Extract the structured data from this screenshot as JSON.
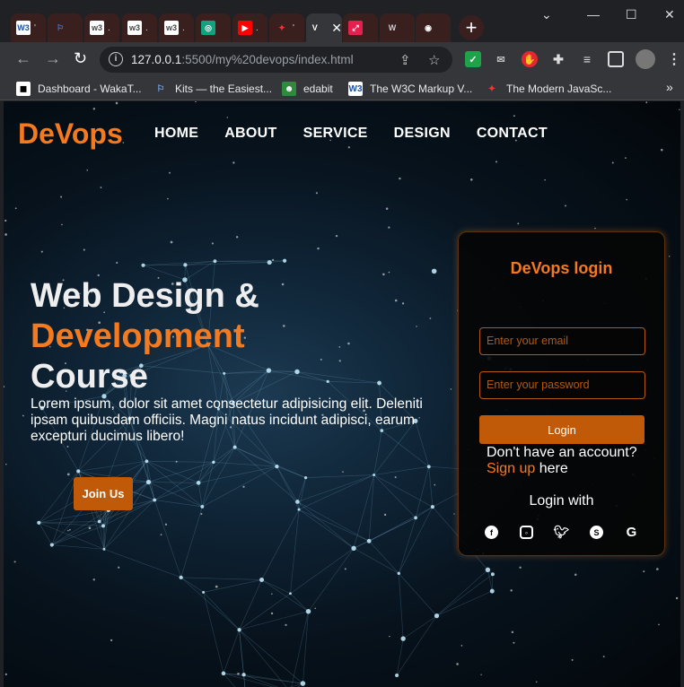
{
  "browser": {
    "tabs": [
      {
        "icon": "W3",
        "label": "'",
        "color": "#1e4fa1",
        "bg": "#fff"
      },
      {
        "icon": "⚐",
        "label": "",
        "color": "#3b82f6",
        "bg": "transparent"
      },
      {
        "icon": "w3",
        "label": ".",
        "color": "#444",
        "bg": "#fff"
      },
      {
        "icon": "w3",
        "label": ".",
        "color": "#444",
        "bg": "#fff"
      },
      {
        "icon": "w3",
        "label": ".",
        "color": "#444",
        "bg": "#fff"
      },
      {
        "icon": "◎",
        "label": "",
        "color": "#fff",
        "bg": "#10a37f"
      },
      {
        "icon": "▶",
        "label": ".",
        "color": "#fff",
        "bg": "#ff0000"
      },
      {
        "icon": "✦",
        "label": "'",
        "color": "#ff3333",
        "bg": "transparent"
      },
      {
        "icon": "V",
        "label": "",
        "color": "#fff",
        "bg": "transparent"
      },
      {
        "icon": "⤢",
        "label": "",
        "color": "#fff",
        "bg": "#e5204f"
      },
      {
        "icon": "W",
        "label": "",
        "color": "#ccc",
        "bg": "transparent"
      },
      {
        "icon": "◉",
        "label": "",
        "color": "#fff",
        "bg": "transparent"
      }
    ],
    "new_tab": "+",
    "url_host": "127.0.0.1",
    "url_rest": ":5500/my%20devops/index.html",
    "bookmarks": [
      {
        "label": "Dashboard - WakaT...",
        "icon": "◼",
        "color": "#000",
        "bg": "#fff"
      },
      {
        "label": "Kits — the Easiest...",
        "icon": "⚐",
        "color": "#6ea8ff",
        "bg": "transparent"
      },
      {
        "label": "edabit",
        "icon": "☻",
        "color": "#fff",
        "bg": "#2e8b3e"
      },
      {
        "label": "The W3C Markup V...",
        "icon": "W3",
        "color": "#1e4fa1",
        "bg": "#fff"
      },
      {
        "label": "The Modern JavaSc...",
        "icon": "✦",
        "color": "#ff3333",
        "bg": "transparent"
      }
    ],
    "bookmarks_more": "»"
  },
  "site": {
    "logo": "DeVops",
    "nav": [
      "HOME",
      "ABOUT",
      "SERVICE",
      "DESIGN",
      "CONTACT"
    ],
    "hero": {
      "line1": "Web Design &",
      "line2": "Development",
      "line3": "Course",
      "text": "Lorem ipsum, dolor sit amet consectetur adipisicing elit. Deleniti ipsam quibusdam officiis. Magni natus incidunt adipisci, earum excepturi ducimus libero!",
      "button": "Join Us"
    },
    "login": {
      "title": "DeVops login",
      "email_placeholder": "Enter your email",
      "password_placeholder": "Enter your password",
      "button": "Login",
      "no_account": "Don't have an account?",
      "signup": "Sign up",
      "here": " here",
      "login_with": "Login with",
      "socials": [
        "facebook",
        "instagram",
        "twitter",
        "skype",
        "google"
      ]
    }
  },
  "colors": {
    "accent": "#f47a1f",
    "button": "#c15a08"
  }
}
